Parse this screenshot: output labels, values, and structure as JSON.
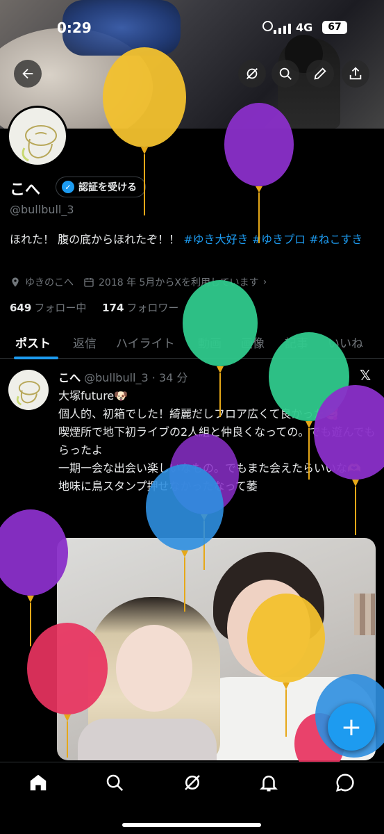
{
  "status_bar": {
    "time": "0:29",
    "network": "4G",
    "battery": "67"
  },
  "profile": {
    "name": "こへ",
    "verify_label": "認証を受ける",
    "handle": "@bullbull_3",
    "bio_text": "ほれた！ 腹の底からほれたぞ！！ ",
    "bio_tags": [
      "#ゆき大好き",
      "#ゆきプロ",
      "#ねこすき"
    ],
    "location": "ゆきのこへ",
    "joined": "2018 年 5月からXを利用しています",
    "following_count": "649",
    "following_label": "フォロー中",
    "followers_count": "174",
    "followers_label": "フォロワー"
  },
  "tabs": [
    "ポスト",
    "返信",
    "ハイライト",
    "動画",
    "画像",
    "記事",
    "いいね"
  ],
  "post": {
    "name": "こへ",
    "handle_time": "@bullbull_3 · 34 分",
    "lines": [
      "大塚future🐶",
      "個人的、初箱でした！綺麗だしフロア広くて良かった🥰",
      "喫煙所で地下初ライブの2人組と仲良くなっての。でも遊んでもらったよ",
      "一期一会な出会い楽しいなもの。でもまた会えたらいいな🫶",
      "地味に鳥スタンプ押せなかったなって萎"
    ]
  },
  "icons": {
    "back": "arrow-left-icon",
    "grok": "grok-icon",
    "search": "search-icon",
    "edit": "pencil-icon",
    "share": "share-icon",
    "location": "location-pin-icon",
    "calendar": "calendar-icon",
    "chevron": "chevron-right-icon",
    "x_logo": "x-logo-icon",
    "compose": "plus-icon",
    "home": "home-icon",
    "notifications": "bell-icon",
    "messages": "chat-bubble-icon"
  },
  "colors": {
    "accent": "#1d9bf0",
    "muted": "#71767b",
    "text": "#e7e9ea",
    "background": "#000000",
    "balloon_yellow": "#f2c12e",
    "balloon_purple": "#8a2fc9",
    "balloon_green": "#2fc98c",
    "balloon_blue": "#2f8fe0",
    "balloon_pink": "#e8335f"
  }
}
